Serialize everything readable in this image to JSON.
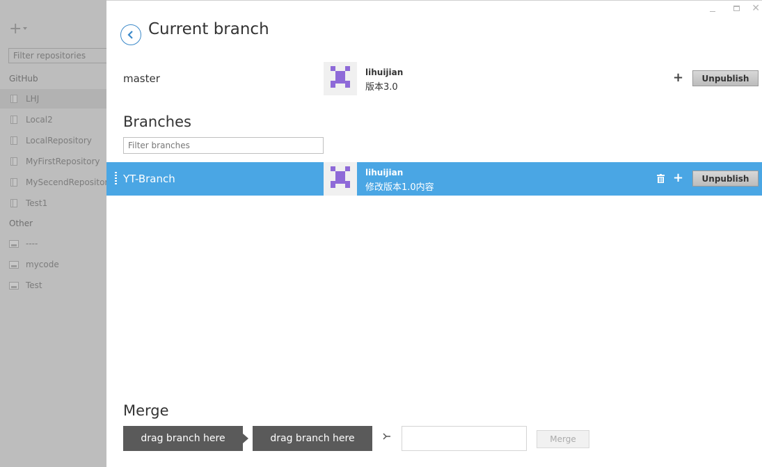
{
  "sidebar": {
    "add_icon": "plus-icon",
    "filter_placeholder": "Filter repositories",
    "headings": {
      "github": "GitHub",
      "other": "Other"
    },
    "github_repos": [
      "LHJ",
      "Local2",
      "LocalRepository",
      "MyFirstRepository",
      "MySecendRepository",
      "Test1"
    ],
    "other_repos": [
      "----",
      "mycode",
      "Test"
    ],
    "active_repo": "LHJ"
  },
  "header": {
    "title": "Current branch",
    "back_icon": "chevron-left-icon"
  },
  "current_branch": {
    "name": "master",
    "author": "lihuijian",
    "message": "版本3.0",
    "unpublish_label": "Unpublish",
    "plus_label": "+"
  },
  "branches": {
    "title": "Branches",
    "filter_placeholder": "Filter branches",
    "items": [
      {
        "name": "YT-Branch",
        "author": "lihuijian",
        "message": "修改版本1.0内容",
        "unpublish_label": "Unpublish",
        "plus_label": "+",
        "selected": true
      }
    ]
  },
  "merge": {
    "title": "Merge",
    "source_label": "drag branch here",
    "target_label": "drag branch here",
    "button_label": "Merge"
  },
  "colors": {
    "accent": "#4aa6e4",
    "sidebar_bg": "#bdbdbd",
    "avatar_identicon": "#8e6ad8",
    "dropzone_bg": "#5a5a5a"
  }
}
